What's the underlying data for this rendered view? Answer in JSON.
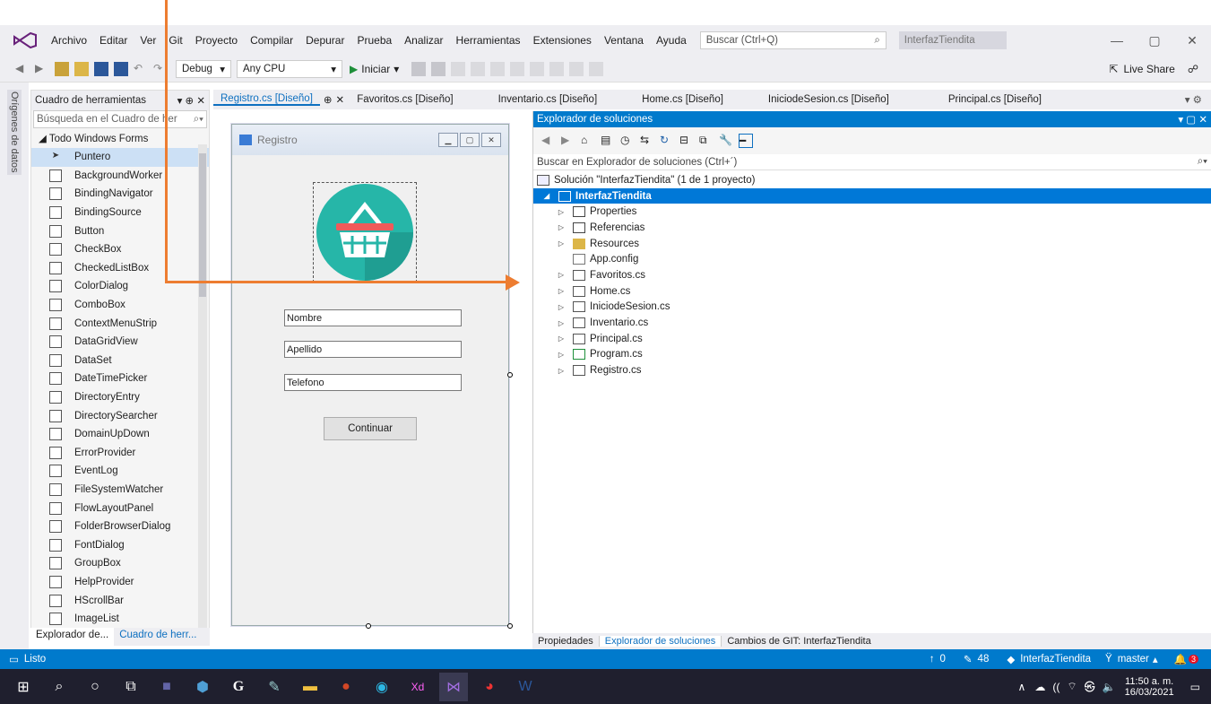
{
  "menubar": {
    "items": [
      "Archivo",
      "Editar",
      "Ver",
      "Git",
      "Proyecto",
      "Compilar",
      "Depurar",
      "Prueba",
      "Analizar",
      "Herramientas",
      "Extensiones",
      "Ventana",
      "Ayuda"
    ],
    "search_placeholder": "Buscar (Ctrl+Q)",
    "solution_name": "InterfazTiendita"
  },
  "toolbar": {
    "config": "Debug",
    "platform": "Any CPU",
    "run_label": "Iniciar",
    "live_share": "Live Share"
  },
  "left_strip_label": "Orígenes de datos",
  "toolbox": {
    "title": "Cuadro de herramientas",
    "search_placeholder": "Búsqueda en el Cuadro de her",
    "group": "◢ Todo Windows Forms",
    "items": [
      "Puntero",
      "BackgroundWorker",
      "BindingNavigator",
      "BindingSource",
      "Button",
      "CheckBox",
      "CheckedListBox",
      "ColorDialog",
      "ComboBox",
      "ContextMenuStrip",
      "DataGridView",
      "DataSet",
      "DateTimePicker",
      "DirectoryEntry",
      "DirectorySearcher",
      "DomainUpDown",
      "ErrorProvider",
      "EventLog",
      "FileSystemWatcher",
      "FlowLayoutPanel",
      "FolderBrowserDialog",
      "FontDialog",
      "GroupBox",
      "HelpProvider",
      "HScrollBar",
      "ImageList"
    ],
    "tabs": [
      "Explorador de...",
      "Cuadro de herr..."
    ]
  },
  "doc_tabs": [
    "Registro.cs [Diseño]",
    "Favoritos.cs [Diseño]",
    "Inventario.cs [Diseño]",
    "Home.cs [Diseño]",
    "IniciodeSesion.cs [Diseño]",
    "Principal.cs [Diseño]"
  ],
  "form": {
    "title": "Registro",
    "fields": [
      "Nombre",
      "Apellido",
      "Telefono"
    ],
    "button": "Continuar"
  },
  "solution_explorer": {
    "title": "Explorador de soluciones",
    "search_placeholder": "Buscar en Explorador de soluciones (Ctrl+´)",
    "solution": "Solución \"InterfazTiendita\" (1 de 1 proyecto)",
    "project": "InterfazTiendita",
    "items": [
      "Properties",
      "Referencias",
      "Resources",
      "App.config",
      "Favoritos.cs",
      "Home.cs",
      "IniciodeSesion.cs",
      "Inventario.cs",
      "Principal.cs",
      "Program.cs",
      "Registro.cs"
    ],
    "bottom_tabs": [
      "Propiedades",
      "Explorador de soluciones",
      "Cambios de GIT: InterfazTiendita"
    ]
  },
  "statusbar": {
    "status": "Listo",
    "up_count": "0",
    "edits": "48",
    "repo": "InterfazTiendita",
    "branch": "master",
    "notifications": "3"
  },
  "taskbar": {
    "time": "11:50 a. m.",
    "date": "16/03/2021"
  },
  "colors": {
    "accent": "#007acc",
    "arrow": "#ed7d31",
    "selection": "#0078d7"
  }
}
